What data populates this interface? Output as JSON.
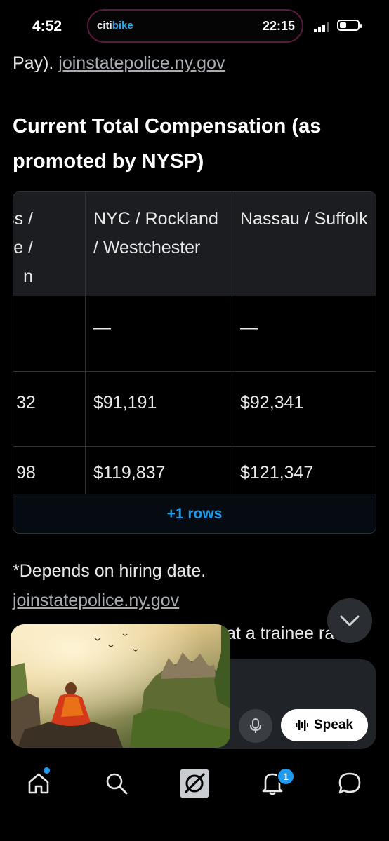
{
  "status_bar": {
    "time": "4:52",
    "island_app_prefix": "citi",
    "island_app_suffix": "bike",
    "island_time": "22:15"
  },
  "article": {
    "top_line_prefix": "Pay). ",
    "top_line_link": "joinstatepolice.ny.gov",
    "heading": "Current Total Compensation (as promoted by NYSP)",
    "table": {
      "headers": [
        "ess / e / n",
        "NYC / Rockland / Westchester",
        "Nassau / Suffolk"
      ],
      "rows": [
        [
          "",
          "—",
          "—"
        ],
        [
          "32",
          "$91,191",
          "$92,341"
        ],
        [
          "98",
          "$119,837",
          "$121,347"
        ]
      ],
      "more_rows_label": "+1 rows"
    },
    "footnote_text": "*Depends on hiring date.",
    "footnote_link": "joinstatepolice.ny.gov",
    "partial_text": "at a trainee rate"
  },
  "compose": {
    "speak_label": "Speak"
  },
  "bottom_nav": {
    "items": [
      "home",
      "search",
      "grok",
      "notifications",
      "messages"
    ],
    "notification_count": "1"
  },
  "colors": {
    "accent": "#1d9bf0",
    "background": "#000000",
    "table_header": "#1b1d20",
    "border": "#2f3336"
  }
}
